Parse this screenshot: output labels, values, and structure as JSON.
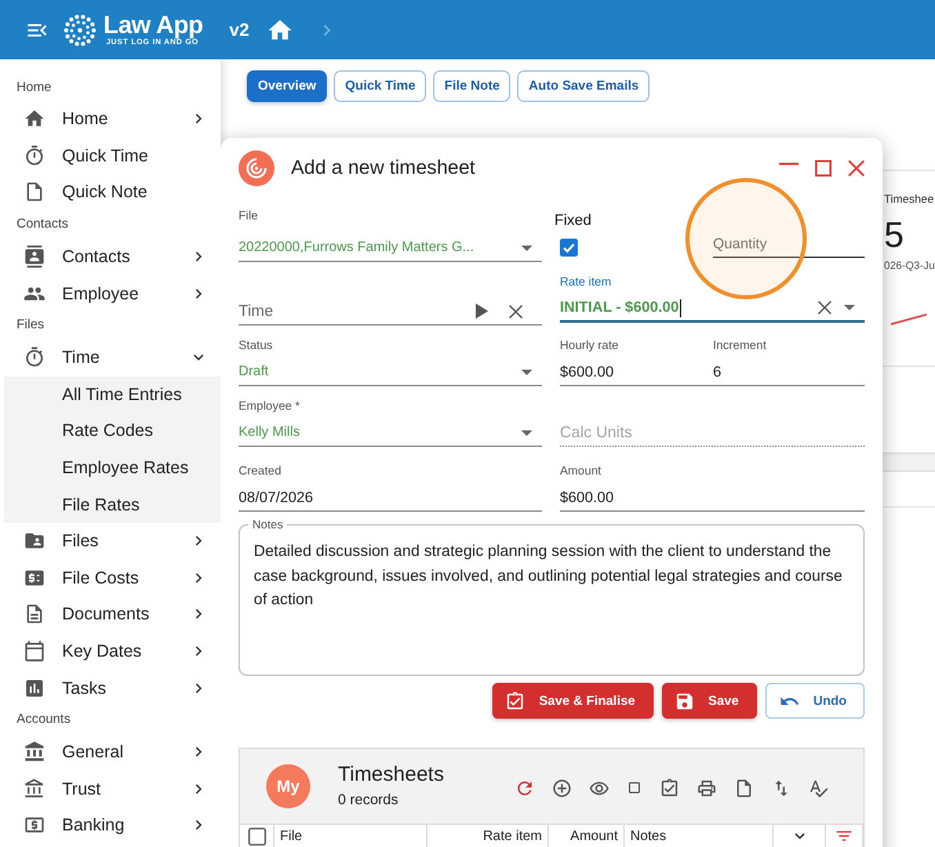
{
  "app_bar": {
    "logo_name": "Law App",
    "logo_tagline": "JUST LOG IN AND GO",
    "version": "v2"
  },
  "sidebar": {
    "sections": [
      {
        "title": "Home",
        "items": [
          {
            "label": "Home",
            "expanded": false
          },
          {
            "label": "Quick Time"
          },
          {
            "label": "Quick Note"
          }
        ]
      },
      {
        "title": "Contacts",
        "items": [
          {
            "label": "Contacts",
            "expanded": false
          },
          {
            "label": "Employee",
            "expanded": false
          }
        ]
      },
      {
        "title": "Files",
        "items": [
          {
            "label": "Time",
            "expanded": true,
            "children": [
              {
                "label": "All Time Entries"
              },
              {
                "label": "Rate Codes"
              },
              {
                "label": "Employee Rates"
              },
              {
                "label": "File Rates"
              }
            ]
          },
          {
            "label": "Files",
            "expanded": false
          },
          {
            "label": "File Costs",
            "expanded": false
          },
          {
            "label": "Documents",
            "expanded": false
          },
          {
            "label": "Key Dates",
            "expanded": false
          },
          {
            "label": "Tasks",
            "expanded": false
          }
        ]
      },
      {
        "title": "Accounts",
        "items": [
          {
            "label": "General",
            "expanded": false
          },
          {
            "label": "Trust",
            "expanded": false
          },
          {
            "label": "Banking",
            "expanded": false
          }
        ]
      }
    ]
  },
  "tabs": [
    {
      "label": "Overview",
      "selected": true
    },
    {
      "label": "Quick Time",
      "selected": false
    },
    {
      "label": "File Note",
      "selected": false
    },
    {
      "label": "Auto Save Emails",
      "selected": false
    }
  ],
  "page": {
    "summary_card": {
      "title": "Timeshee",
      "value": "5",
      "period": "026-Q3-Ju"
    }
  },
  "dialog": {
    "title": "Add a new timesheet",
    "file": {
      "label": "File",
      "value": "20220000,Furrows Family Matters G..."
    },
    "fixed": {
      "label": "Fixed",
      "checked": true
    },
    "quantity": {
      "placeholder": "Quantity"
    },
    "time": {
      "placeholder": "Time"
    },
    "rate_item": {
      "label": "Rate item",
      "value": "INITIAL - $600.00",
      "focused": true
    },
    "status": {
      "label": "Status",
      "value": "Draft"
    },
    "hourly_rate": {
      "label": "Hourly rate",
      "value": "$600.00"
    },
    "increment": {
      "label": "Increment",
      "value": "6"
    },
    "employee": {
      "label": "Employee *",
      "value": "Kelly Mills"
    },
    "calc_units": {
      "placeholder": "Calc Units",
      "disabled": true
    },
    "created": {
      "label": "Created",
      "value": "08/07/2026"
    },
    "amount": {
      "label": "Amount",
      "value": "$600.00"
    },
    "notes": {
      "label": "Notes",
      "value": "Detailed discussion and strategic planning session with the client to understand the case background, issues involved, and outlining potential legal strategies and course of action"
    },
    "buttons": [
      {
        "label": "Save & Finalise",
        "kind": "finalise"
      },
      {
        "label": "Save",
        "kind": "save"
      },
      {
        "label": "Undo",
        "kind": "undo"
      }
    ],
    "timesheets": {
      "avatar": "My",
      "title": "Timesheets",
      "count": "0 records",
      "select_all": {
        "checked": false
      },
      "columns": [
        "File",
        "Rate item",
        "Amount",
        "Notes"
      ]
    }
  }
}
